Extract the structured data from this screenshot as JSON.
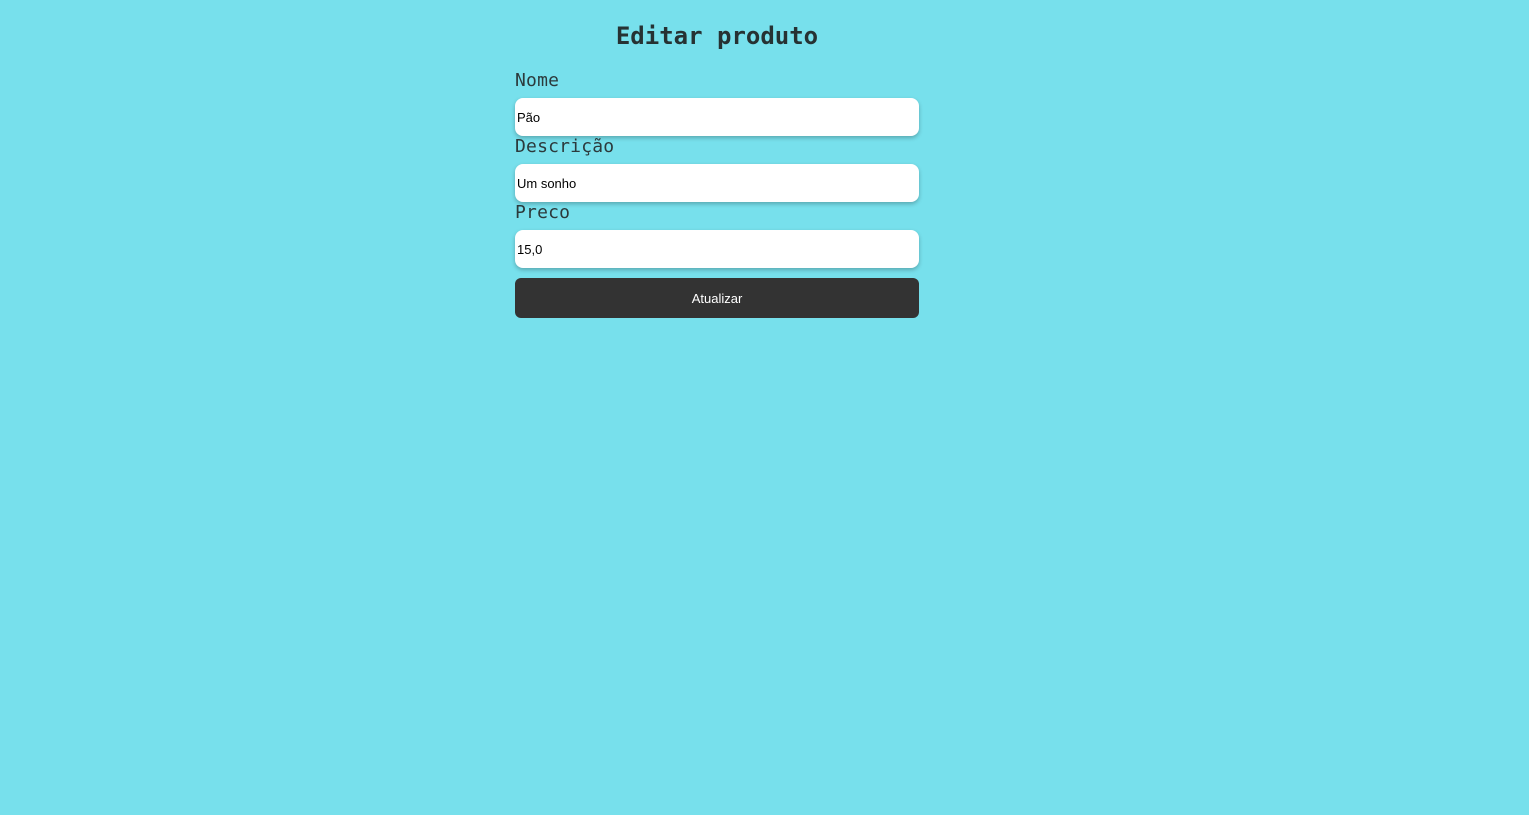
{
  "page": {
    "title": "Editar produto",
    "background": "#77e0ec"
  },
  "form": {
    "fields": [
      {
        "label": "Nome",
        "value": "Pão"
      },
      {
        "label": "Descrição",
        "value": "Um sonho"
      },
      {
        "label": "Preco",
        "value": "15,0"
      }
    ],
    "submit_label": "Atualizar"
  }
}
